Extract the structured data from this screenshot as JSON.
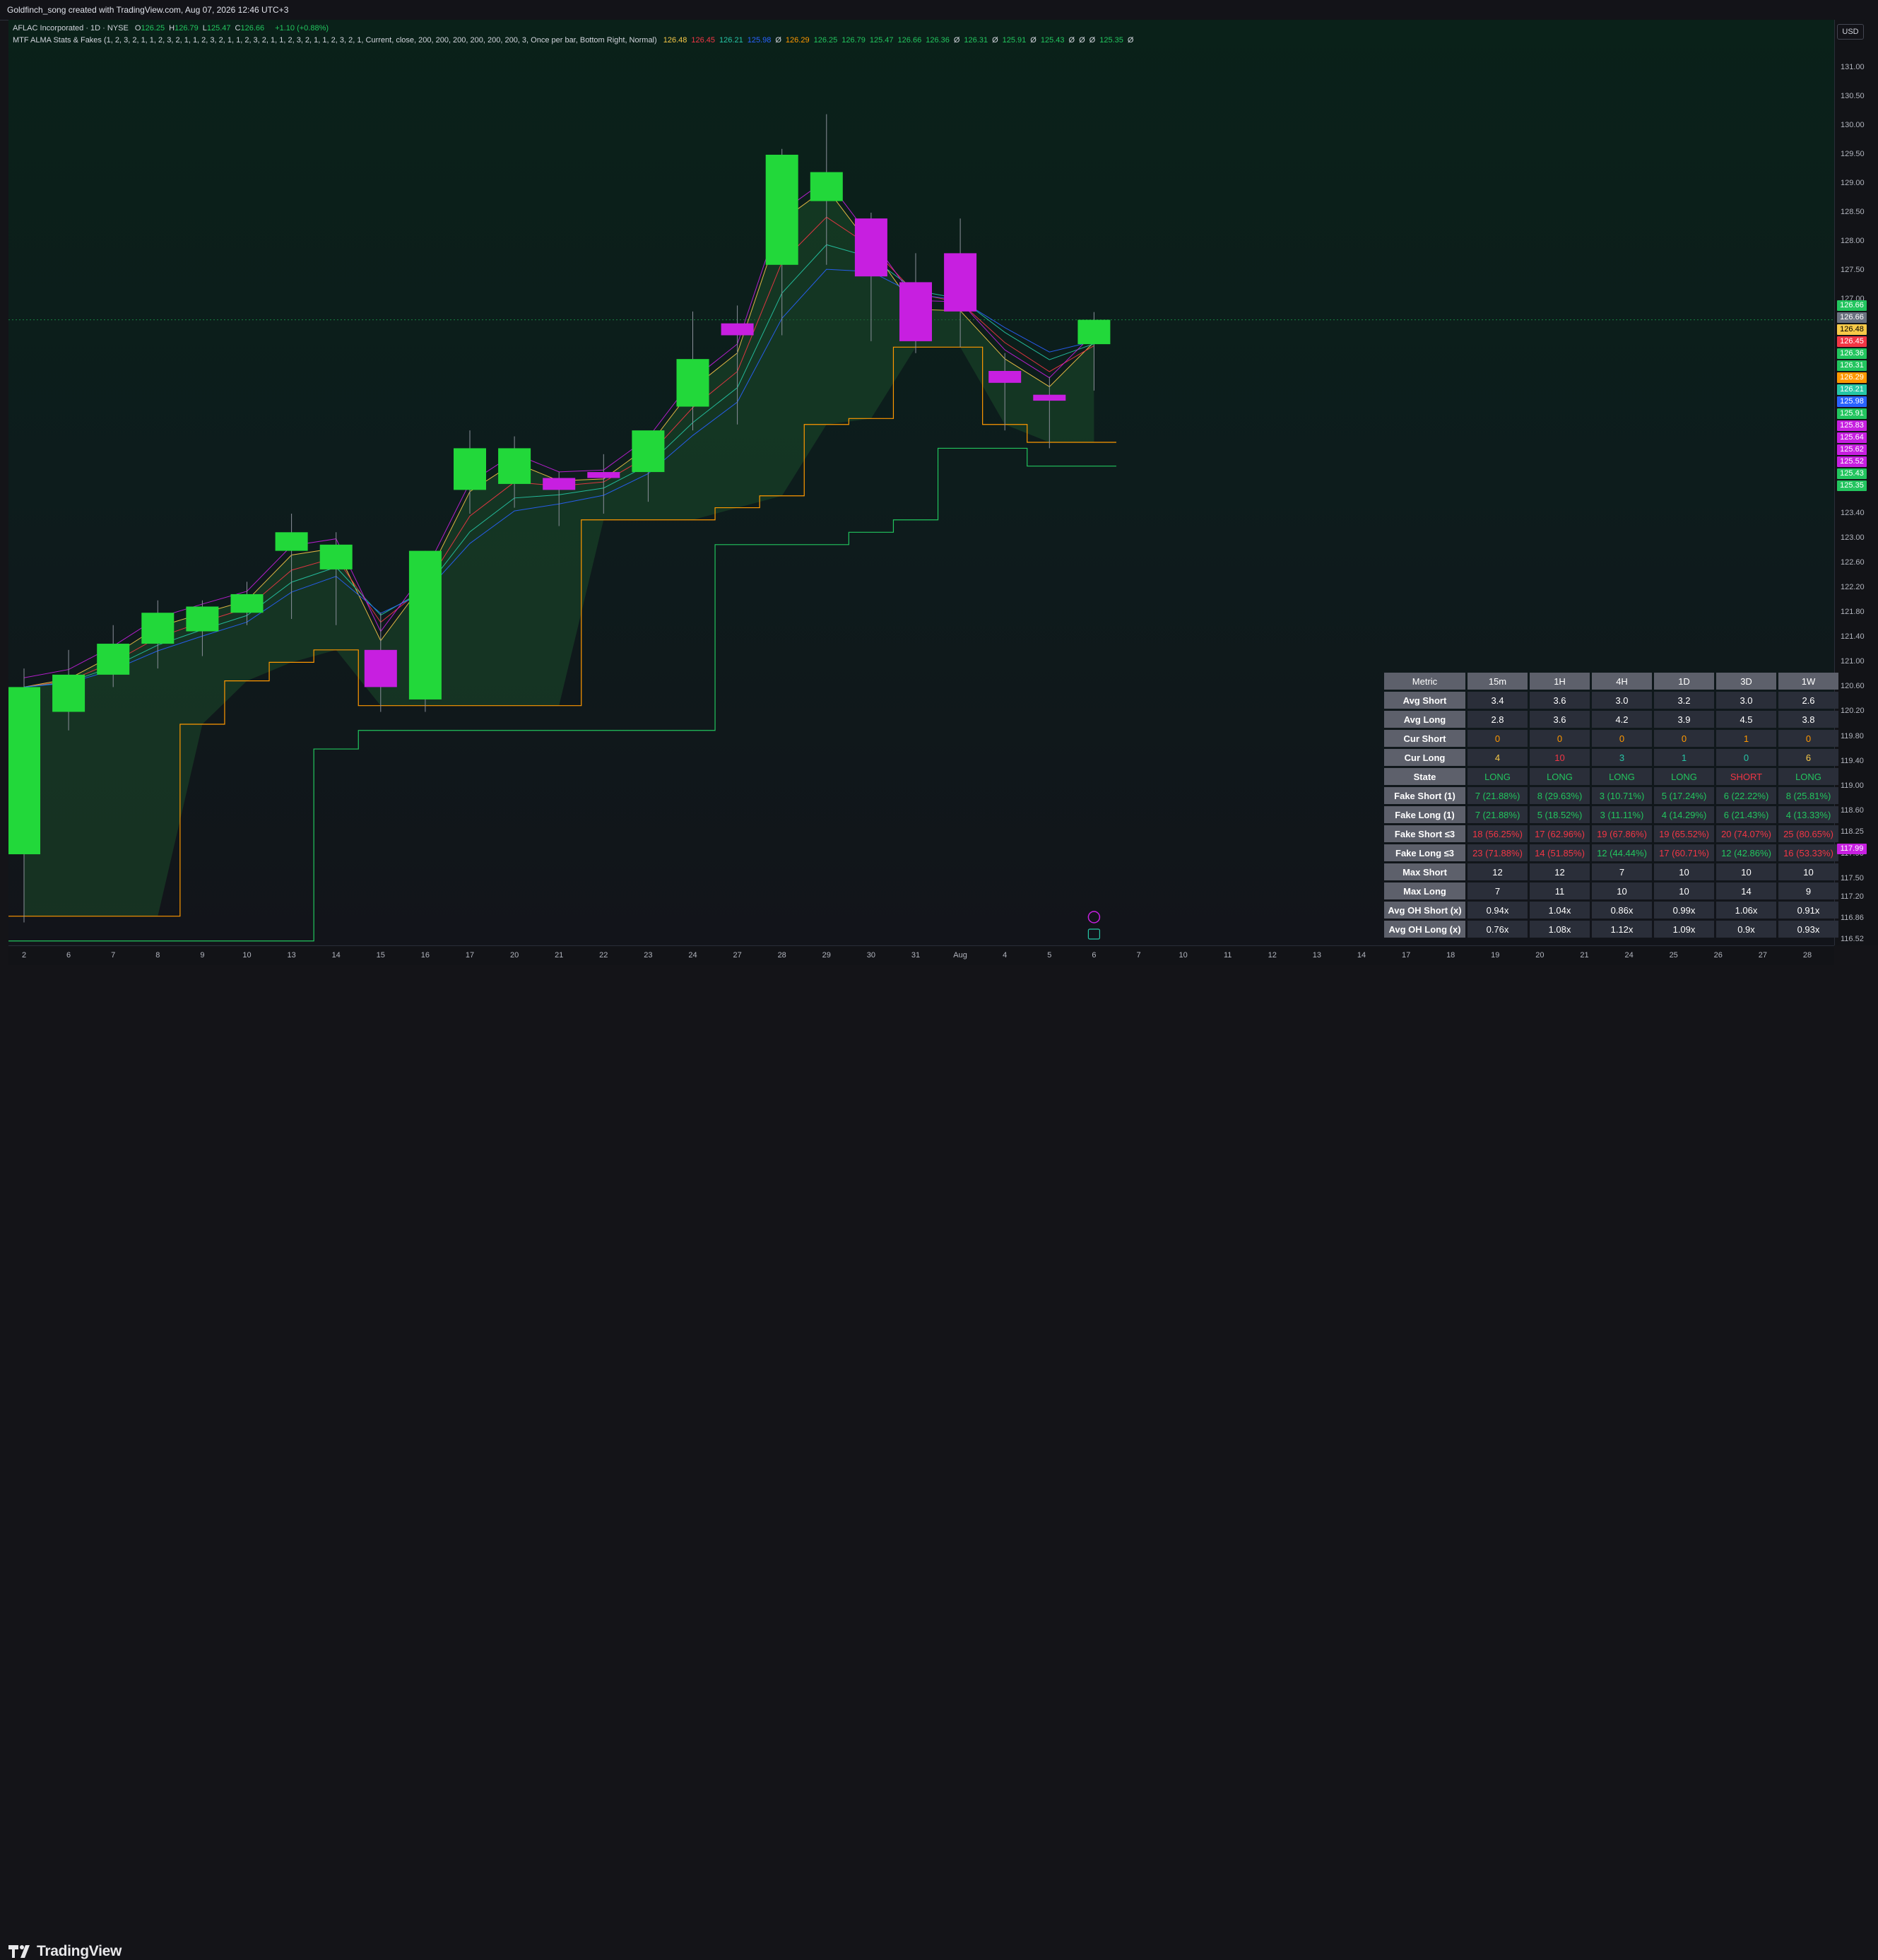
{
  "header": {
    "credit": "Goldfinch_song created with TradingView.com, Aug 07, 2026 12:46 UTC+3"
  },
  "legend": {
    "symbol": "AFLAC Incorporated · 1D · NYSE",
    "ohlc": [
      {
        "k": "O",
        "v": "126.25"
      },
      {
        "k": "H",
        "v": "126.79"
      },
      {
        "k": "L",
        "v": "125.47"
      },
      {
        "k": "C",
        "v": "126.66"
      }
    ],
    "change": "+1.10 (+0.88%)",
    "indicator": "MTF ALMA Stats & Fakes (1, 2, 3, 2, 1, 1, 2, 3, 2, 1, 1, 2, 3, 2, 1, 1, 2, 3, 2, 1, 1, 2, 3, 2, 1, 1, 2, 3, 2, 1, Current, close, 200, 200, 200, 200, 200, 200, 3, Once per bar, Bottom Right, Normal)",
    "values": [
      {
        "v": "126.48",
        "c": "#f7c948"
      },
      {
        "v": "126.45",
        "c": "#f23645"
      },
      {
        "v": "126.21",
        "c": "#26c6a6"
      },
      {
        "v": "125.98",
        "c": "#2962ff"
      },
      {
        "v": "Ø",
        "c": "#d1d4dc"
      },
      {
        "v": "126.29",
        "c": "#ff9800"
      },
      {
        "v": "126.25",
        "c": "#22c55e"
      },
      {
        "v": "126.79",
        "c": "#22c55e"
      },
      {
        "v": "125.47",
        "c": "#22c55e"
      },
      {
        "v": "126.66",
        "c": "#22c55e"
      },
      {
        "v": "126.36",
        "c": "#22c55e"
      },
      {
        "v": "Ø",
        "c": "#d1d4dc"
      },
      {
        "v": "126.31",
        "c": "#22c55e"
      },
      {
        "v": "Ø",
        "c": "#d1d4dc"
      },
      {
        "v": "125.91",
        "c": "#22c55e"
      },
      {
        "v": "Ø",
        "c": "#d1d4dc"
      },
      {
        "v": "125.43",
        "c": "#22c55e"
      },
      {
        "v": "Ø",
        "c": "#d1d4dc"
      },
      {
        "v": "Ø",
        "c": "#d1d4dc"
      },
      {
        "v": "Ø",
        "c": "#d1d4dc"
      },
      {
        "v": "125.35",
        "c": "#22c55e"
      },
      {
        "v": "Ø",
        "c": "#d1d4dc"
      }
    ]
  },
  "currency": "USD",
  "colors": {
    "bull": "#22d83a",
    "bear": "#c71fe0",
    "alma_fill": "#1c4a2a"
  },
  "chart_data": {
    "type": "candlestick",
    "ylim": [
      116.3,
      131.6
    ],
    "y_ticks": [
      "131.00",
      "130.50",
      "130.00",
      "129.50",
      "129.00",
      "128.50",
      "128.00",
      "127.50",
      "127.00",
      "123.40",
      "123.00",
      "122.60",
      "122.20",
      "121.80",
      "121.40",
      "121.00",
      "120.60",
      "120.20",
      "119.80",
      "119.40",
      "119.00",
      "118.60",
      "118.25",
      "117.90",
      "117.50",
      "117.20",
      "116.86",
      "116.52"
    ],
    "x_ticks": [
      "2",
      "6",
      "7",
      "8",
      "9",
      "10",
      "13",
      "14",
      "15",
      "16",
      "17",
      "20",
      "21",
      "22",
      "23",
      "24",
      "27",
      "28",
      "29",
      "30",
      "31",
      "Aug",
      "4",
      "5",
      "6",
      "7",
      "10",
      "11",
      "12",
      "13",
      "14",
      "17",
      "18",
      "19",
      "20",
      "21",
      "24",
      "25",
      "26",
      "27",
      "28"
    ],
    "candles": [
      {
        "o": 117.9,
        "h": 120.9,
        "l": 116.8,
        "c": 120.6
      },
      {
        "o": 120.2,
        "h": 121.2,
        "l": 119.9,
        "c": 120.8
      },
      {
        "o": 120.8,
        "h": 121.6,
        "l": 120.6,
        "c": 121.3
      },
      {
        "o": 121.3,
        "h": 122.0,
        "l": 120.9,
        "c": 121.8
      },
      {
        "o": 121.5,
        "h": 122.0,
        "l": 121.1,
        "c": 121.9
      },
      {
        "o": 121.8,
        "h": 122.3,
        "l": 121.6,
        "c": 122.1
      },
      {
        "o": 122.8,
        "h": 123.4,
        "l": 121.7,
        "c": 123.1
      },
      {
        "o": 122.5,
        "h": 123.1,
        "l": 121.6,
        "c": 122.9
      },
      {
        "o": 121.2,
        "h": 121.8,
        "l": 120.2,
        "c": 120.6
      },
      {
        "o": 120.4,
        "h": 122.8,
        "l": 120.2,
        "c": 122.8
      },
      {
        "o": 123.8,
        "h": 124.8,
        "l": 123.4,
        "c": 124.5
      },
      {
        "o": 123.9,
        "h": 124.7,
        "l": 123.5,
        "c": 124.5
      },
      {
        "o": 124.0,
        "h": 124.1,
        "l": 123.2,
        "c": 123.8
      },
      {
        "o": 124.1,
        "h": 124.4,
        "l": 123.4,
        "c": 124.0
      },
      {
        "o": 124.1,
        "h": 124.7,
        "l": 123.6,
        "c": 124.8
      },
      {
        "o": 125.2,
        "h": 126.8,
        "l": 124.8,
        "c": 126.0
      },
      {
        "o": 126.6,
        "h": 126.9,
        "l": 124.9,
        "c": 126.4
      },
      {
        "o": 127.6,
        "h": 129.6,
        "l": 126.4,
        "c": 129.5
      },
      {
        "o": 128.7,
        "h": 130.2,
        "l": 127.6,
        "c": 129.2
      },
      {
        "o": 128.4,
        "h": 128.5,
        "l": 126.3,
        "c": 127.4
      },
      {
        "o": 127.3,
        "h": 127.8,
        "l": 126.1,
        "c": 126.3
      },
      {
        "o": 127.8,
        "h": 128.4,
        "l": 126.2,
        "c": 126.8
      },
      {
        "o": 125.8,
        "h": 126.1,
        "l": 124.8,
        "c": 125.6
      },
      {
        "o": 125.4,
        "h": 125.7,
        "l": 124.5,
        "c": 125.3
      },
      {
        "o": 126.25,
        "h": 126.79,
        "l": 125.47,
        "c": 126.66
      }
    ],
    "price_tags": [
      {
        "v": "126.66",
        "c": "#22c55e"
      },
      {
        "v": "126.66",
        "c": "#6b7280"
      },
      {
        "v": "126.48",
        "c": "#f7c948"
      },
      {
        "v": "126.45",
        "c": "#f23645"
      },
      {
        "v": "126.36",
        "c": "#22c55e"
      },
      {
        "v": "126.31",
        "c": "#22c55e"
      },
      {
        "v": "126.29",
        "c": "#ff9800"
      },
      {
        "v": "126.21",
        "c": "#26c6a6"
      },
      {
        "v": "125.98",
        "c": "#2962ff"
      },
      {
        "v": "125.91",
        "c": "#22c55e"
      },
      {
        "v": "125.83",
        "c": "#c71fe0"
      },
      {
        "v": "125.64",
        "c": "#c71fe0"
      },
      {
        "v": "125.62",
        "c": "#c71fe0"
      },
      {
        "v": "125.52",
        "c": "#c71fe0"
      },
      {
        "v": "125.43",
        "c": "#22c55e"
      },
      {
        "v": "125.35",
        "c": "#22c55e"
      },
      {
        "v": "117.99",
        "c": "#c71fe0"
      }
    ]
  },
  "stats_table": {
    "headers": [
      "Metric",
      "15m",
      "1H",
      "4H",
      "1D",
      "3D",
      "1W"
    ],
    "rows": [
      {
        "name": "Avg Short",
        "cells": [
          {
            "v": "3.4",
            "c": "#ffffff"
          },
          {
            "v": "3.6",
            "c": "#ffffff"
          },
          {
            "v": "3.0",
            "c": "#ffffff"
          },
          {
            "v": "3.2",
            "c": "#ffffff"
          },
          {
            "v": "3.0",
            "c": "#ffffff"
          },
          {
            "v": "2.6",
            "c": "#ffffff"
          }
        ]
      },
      {
        "name": "Avg Long",
        "cells": [
          {
            "v": "2.8",
            "c": "#ffffff"
          },
          {
            "v": "3.6",
            "c": "#ffffff"
          },
          {
            "v": "4.2",
            "c": "#ffffff"
          },
          {
            "v": "3.9",
            "c": "#ffffff"
          },
          {
            "v": "4.5",
            "c": "#ffffff"
          },
          {
            "v": "3.8",
            "c": "#ffffff"
          }
        ]
      },
      {
        "name": "Cur Short",
        "cells": [
          {
            "v": "0",
            "c": "#ff9800"
          },
          {
            "v": "0",
            "c": "#ff9800"
          },
          {
            "v": "0",
            "c": "#ff9800"
          },
          {
            "v": "0",
            "c": "#ff9800"
          },
          {
            "v": "1",
            "c": "#ff9800"
          },
          {
            "v": "0",
            "c": "#ff9800"
          }
        ]
      },
      {
        "name": "Cur Long",
        "cells": [
          {
            "v": "4",
            "c": "#f7c948"
          },
          {
            "v": "10",
            "c": "#f23645"
          },
          {
            "v": "3",
            "c": "#26c6a6"
          },
          {
            "v": "1",
            "c": "#26c6a6"
          },
          {
            "v": "0",
            "c": "#26c6a6"
          },
          {
            "v": "6",
            "c": "#f7c948"
          }
        ]
      },
      {
        "name": "State",
        "cells": [
          {
            "v": "LONG",
            "c": "#22c55e"
          },
          {
            "v": "LONG",
            "c": "#22c55e"
          },
          {
            "v": "LONG",
            "c": "#22c55e"
          },
          {
            "v": "LONG",
            "c": "#22c55e"
          },
          {
            "v": "SHORT",
            "c": "#f23645"
          },
          {
            "v": "LONG",
            "c": "#22c55e"
          }
        ]
      },
      {
        "name": "Fake Short (1)",
        "cells": [
          {
            "v": "7 (21.88%)",
            "c": "#22c55e"
          },
          {
            "v": "8 (29.63%)",
            "c": "#22c55e"
          },
          {
            "v": "3 (10.71%)",
            "c": "#22c55e"
          },
          {
            "v": "5 (17.24%)",
            "c": "#22c55e"
          },
          {
            "v": "6 (22.22%)",
            "c": "#22c55e"
          },
          {
            "v": "8 (25.81%)",
            "c": "#22c55e"
          }
        ]
      },
      {
        "name": "Fake Long (1)",
        "cells": [
          {
            "v": "7 (21.88%)",
            "c": "#22c55e"
          },
          {
            "v": "5 (18.52%)",
            "c": "#22c55e"
          },
          {
            "v": "3 (11.11%)",
            "c": "#22c55e"
          },
          {
            "v": "4 (14.29%)",
            "c": "#22c55e"
          },
          {
            "v": "6 (21.43%)",
            "c": "#22c55e"
          },
          {
            "v": "4 (13.33%)",
            "c": "#22c55e"
          }
        ]
      },
      {
        "name": "Fake Short ≤3",
        "cells": [
          {
            "v": "18 (56.25%)",
            "c": "#f23645"
          },
          {
            "v": "17 (62.96%)",
            "c": "#f23645"
          },
          {
            "v": "19 (67.86%)",
            "c": "#f23645"
          },
          {
            "v": "19 (65.52%)",
            "c": "#f23645"
          },
          {
            "v": "20 (74.07%)",
            "c": "#f23645"
          },
          {
            "v": "25 (80.65%)",
            "c": "#f23645"
          }
        ]
      },
      {
        "name": "Fake Long ≤3",
        "cells": [
          {
            "v": "23 (71.88%)",
            "c": "#f23645"
          },
          {
            "v": "14 (51.85%)",
            "c": "#f23645"
          },
          {
            "v": "12 (44.44%)",
            "c": "#22c55e"
          },
          {
            "v": "17 (60.71%)",
            "c": "#f23645"
          },
          {
            "v": "12 (42.86%)",
            "c": "#22c55e"
          },
          {
            "v": "16 (53.33%)",
            "c": "#f23645"
          }
        ]
      },
      {
        "name": "Max Short",
        "cells": [
          {
            "v": "12",
            "c": "#ffffff"
          },
          {
            "v": "12",
            "c": "#ffffff"
          },
          {
            "v": "7",
            "c": "#ffffff"
          },
          {
            "v": "10",
            "c": "#ffffff"
          },
          {
            "v": "10",
            "c": "#ffffff"
          },
          {
            "v": "10",
            "c": "#ffffff"
          }
        ]
      },
      {
        "name": "Max Long",
        "cells": [
          {
            "v": "7",
            "c": "#ffffff"
          },
          {
            "v": "11",
            "c": "#ffffff"
          },
          {
            "v": "10",
            "c": "#ffffff"
          },
          {
            "v": "10",
            "c": "#ffffff"
          },
          {
            "v": "14",
            "c": "#ffffff"
          },
          {
            "v": "9",
            "c": "#ffffff"
          }
        ]
      },
      {
        "name": "Avg OH Short (x)",
        "cells": [
          {
            "v": "0.94x",
            "c": "#ffffff"
          },
          {
            "v": "1.04x",
            "c": "#ffffff"
          },
          {
            "v": "0.86x",
            "c": "#ffffff"
          },
          {
            "v": "0.99x",
            "c": "#ffffff"
          },
          {
            "v": "1.06x",
            "c": "#ffffff"
          },
          {
            "v": "0.91x",
            "c": "#ffffff"
          }
        ]
      },
      {
        "name": "Avg OH Long (x)",
        "cells": [
          {
            "v": "0.76x",
            "c": "#ffffff"
          },
          {
            "v": "1.08x",
            "c": "#ffffff"
          },
          {
            "v": "1.12x",
            "c": "#ffffff"
          },
          {
            "v": "1.09x",
            "c": "#ffffff"
          },
          {
            "v": "0.9x",
            "c": "#ffffff"
          },
          {
            "v": "0.93x",
            "c": "#ffffff"
          }
        ]
      }
    ]
  },
  "footer": {
    "brand": "TradingView"
  }
}
